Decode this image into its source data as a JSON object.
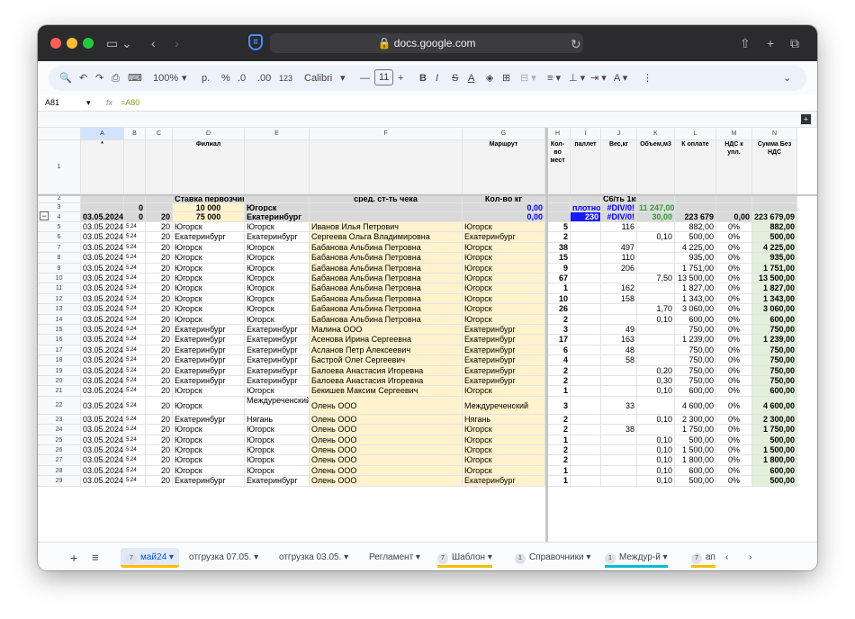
{
  "browser": {
    "url": "docs.google.com"
  },
  "toolbar": {
    "zoom": "100%",
    "currency": "р.",
    "percent": "%",
    "dec_minus": ".0",
    "dec_plus": ".00",
    "format123": "123",
    "font": "Calibri",
    "font_size": "11"
  },
  "formula": {
    "cell_ref": "A81",
    "fx": "fx",
    "content": "=A80"
  },
  "columns": [
    "A",
    "B",
    "C",
    "D",
    "E",
    "F",
    "G",
    "H",
    "I",
    "J",
    "K",
    "L",
    "M",
    "N"
  ],
  "row_numbers": [
    "1",
    "2",
    "3",
    "4",
    "5",
    "6",
    "7",
    "8",
    "9",
    "10",
    "11",
    "12",
    "13",
    "14",
    "15",
    "16",
    "17",
    "18",
    "19",
    "20",
    "21",
    "22",
    "23",
    "24",
    "25",
    "26",
    "27",
    "28",
    "29"
  ],
  "header_row": {
    "a": "*",
    "d": "Филиал",
    "g": "Маршрут",
    "h": "Кол-во мест",
    "i": "паллет",
    "j": "Вес,кг",
    "k": "Объем,м3",
    "l": "К оплате",
    "m": "НДС к упл.",
    "n": "Сумма Без НДС"
  },
  "row2": {
    "d": "Ставка первозчика",
    "f": "сред. ст-ть чека",
    "g": "Кол-во кг",
    "j": "С6/ть 1кг"
  },
  "row3": {
    "b": "0",
    "d": "10 000",
    "e": "Югорск",
    "g": "0,00",
    "i": "плотност",
    "j": "#DIV/0!",
    "k": "11 247,00"
  },
  "row4": {
    "a": "03.05.2024",
    "b": "0",
    "c": "20",
    "d": "75 000",
    "e": "Екатеринбург",
    "g": "0,00",
    "i": "230",
    "j": "#DIV/0!",
    "k": "30,00",
    "l": "223 679",
    "m": "0,00",
    "n": "223 679,09"
  },
  "rows": [
    [
      "03.05.2024",
      "5.24",
      "20",
      "Югорск",
      "Югорск",
      "Иванов Илья Петрович",
      "Югорск",
      "5",
      "",
      "116",
      "",
      "882,00",
      "0%",
      "882,00"
    ],
    [
      "03.05.2024",
      "5.24",
      "20",
      "Екатеринбург",
      "Екатеринбург",
      "Сергеева Ольга Владимировна",
      "Екатеринбург",
      "2",
      "",
      "",
      "0,10",
      "500,00",
      "0%",
      "500,00"
    ],
    [
      "03.05.2024",
      "5.24",
      "20",
      "Югорск",
      "Югорск",
      "Бабанова Альбина Петровна",
      "Югорск",
      "38",
      "",
      "497",
      "",
      "4 225,00",
      "0%",
      "4 225,00"
    ],
    [
      "03.05.2024",
      "5.24",
      "20",
      "Югорск",
      "Югорск",
      "Бабанова Альбина Петровна",
      "Югорск",
      "15",
      "",
      "110",
      "",
      "935,00",
      "0%",
      "935,00"
    ],
    [
      "03.05.2024",
      "5.24",
      "20",
      "Югорск",
      "Югорск",
      "Бабанова Альбина Петровна",
      "Югорск",
      "9",
      "",
      "206",
      "",
      "1 751,00",
      "0%",
      "1 751,00"
    ],
    [
      "03.05.2024",
      "5.24",
      "20",
      "Югорск",
      "Югорск",
      "Бабанова Альбина Петровна",
      "Югорск",
      "67",
      "",
      "",
      "7,50",
      "13 500,00",
      "0%",
      "13 500,00"
    ],
    [
      "03.05.2024",
      "5.24",
      "20",
      "Югорск",
      "Югорск",
      "Бабанова Альбина Петровна",
      "Югорск",
      "1",
      "",
      "162",
      "",
      "1 827,00",
      "0%",
      "1 827,00"
    ],
    [
      "03.05.2024",
      "5.24",
      "20",
      "Югорск",
      "Югорск",
      "Бабанова Альбина Петровна",
      "Югорск",
      "10",
      "",
      "158",
      "",
      "1 343,00",
      "0%",
      "1 343,00"
    ],
    [
      "03.05.2024",
      "5.24",
      "20",
      "Югорск",
      "Югорск",
      "Бабанова Альбина Петровна",
      "Югорск",
      "26",
      "",
      "",
      "1,70",
      "3 060,00",
      "0%",
      "3 060,00"
    ],
    [
      "03.05.2024",
      "5.24",
      "20",
      "Югорск",
      "Югорск",
      "Бабанова Альбина Петровна",
      "Югорск",
      "2",
      "",
      "",
      "0,10",
      "600,00",
      "0%",
      "600,00"
    ],
    [
      "03.05.2024",
      "5.24",
      "20",
      "Екатеринбург",
      "Екатеринбург",
      "Малина ООО",
      "Екатеринбург",
      "3",
      "",
      "49",
      "",
      "750,00",
      "0%",
      "750,00"
    ],
    [
      "03.05.2024",
      "5.24",
      "20",
      "Екатеринбург",
      "Екатеринбург",
      "Асенова Ирина Сергеевна",
      "Екатеринбург",
      "17",
      "",
      "163",
      "",
      "1 239,00",
      "0%",
      "1 239,00"
    ],
    [
      "03.05.2024",
      "5.24",
      "20",
      "Екатеринбург",
      "Екатеринбург",
      "Асланов Петр Алексеевич",
      "Екатеринбург",
      "6",
      "",
      "48",
      "",
      "750,00",
      "0%",
      "750,00"
    ],
    [
      "03.05.2024",
      "5.24",
      "20",
      "Екатеринбург",
      "Екатеринбург",
      "Бастрой Олег Сергеевич",
      "Екатеринбург",
      "4",
      "",
      "58",
      "",
      "750,00",
      "0%",
      "750,00"
    ],
    [
      "03.05.2024",
      "5.24",
      "20",
      "Екатеринбург",
      "Екатеринбург",
      "Балоева Анастасия Игоревна",
      "Екатеринбург",
      "2",
      "",
      "",
      "0,20",
      "750,00",
      "0%",
      "750,00"
    ],
    [
      "03.05.2024",
      "5.24",
      "20",
      "Екатеринбург",
      "Екатеринбург",
      "Балоева Анастасия Игоревна",
      "Екатеринбург",
      "2",
      "",
      "",
      "0,30",
      "750,00",
      "0%",
      "750,00"
    ],
    [
      "03.05.2024",
      "5.24",
      "20",
      "Югорск",
      "Югорск",
      "Бекишев Максим Сергеевич",
      "Югорск",
      "1",
      "",
      "",
      "0,10",
      "600,00",
      "0%",
      "600,00"
    ],
    [
      "03.05.2024",
      "5.24",
      "20",
      "Югорск",
      "Междуреченский",
      "Олень ООО",
      "Междуреченский",
      "3",
      "",
      "33",
      "",
      "4 600,00",
      "0%",
      "4 600,00"
    ],
    [
      "03.05.2024",
      "5.24",
      "20",
      "Екатеринбург",
      "Нягань",
      "Олень ООО",
      "Нягань",
      "2",
      "",
      "",
      "0,10",
      "2 300,00",
      "0%",
      "2 300,00"
    ],
    [
      "03.05.2024",
      "5.24",
      "20",
      "Югорск",
      "Югорск",
      "Олень ООО",
      "Югорск",
      "2",
      "",
      "38",
      "",
      "1 750,00",
      "0%",
      "1 750,00"
    ],
    [
      "03.05.2024",
      "5.24",
      "20",
      "Югорск",
      "Югорск",
      "Олень ООО",
      "Югорск",
      "1",
      "",
      "",
      "0,10",
      "500,00",
      "0%",
      "500,00"
    ],
    [
      "03.05.2024",
      "5.24",
      "20",
      "Югорск",
      "Югорск",
      "Олень ООО",
      "Югорск",
      "2",
      "",
      "",
      "0,10",
      "1 500,00",
      "0%",
      "1 500,00"
    ],
    [
      "03.05.2024",
      "5.24",
      "20",
      "Югорск",
      "Югорск",
      "Олень ООО",
      "Югорск",
      "2",
      "",
      "",
      "0,10",
      "1 800,00",
      "0%",
      "1 800,00"
    ],
    [
      "03.05.2024",
      "5.24",
      "20",
      "Югорск",
      "Югорск",
      "Олень ООО",
      "Югорск",
      "1",
      "",
      "",
      "0,10",
      "600,00",
      "0%",
      "600,00"
    ],
    [
      "03.05.2024",
      "5.24",
      "20",
      "Екатеринбург",
      "Екатеринбург",
      "Олень ООО",
      "Екатеринбург",
      "1",
      "",
      "",
      "0,10",
      "500,00",
      "0%",
      "500,00"
    ]
  ],
  "sheets": [
    {
      "label": "май24",
      "badge": "7",
      "active": true,
      "color": "#fbbc04"
    },
    {
      "label": "отгрузка 07.05.",
      "badge": "",
      "active": false,
      "color": ""
    },
    {
      "label": "отгрузка 03.05.",
      "badge": "",
      "active": false,
      "color": ""
    },
    {
      "label": "Регламент",
      "badge": "",
      "active": false,
      "color": ""
    },
    {
      "label": "Шаблон",
      "badge": "7",
      "active": false,
      "color": "#fbbc04"
    },
    {
      "label": "Справочники",
      "badge": "1",
      "active": false,
      "color": ""
    },
    {
      "label": "Междур-й",
      "badge": "1",
      "active": false,
      "color": "#00bcd4"
    },
    {
      "label": "ап",
      "badge": "7",
      "active": false,
      "color": "#fbbc04"
    }
  ],
  "colors": {
    "sel_blue": "#0000ff",
    "green": "#e2efda",
    "peach": "#fff2cc",
    "gray": "#d9d9d9"
  }
}
